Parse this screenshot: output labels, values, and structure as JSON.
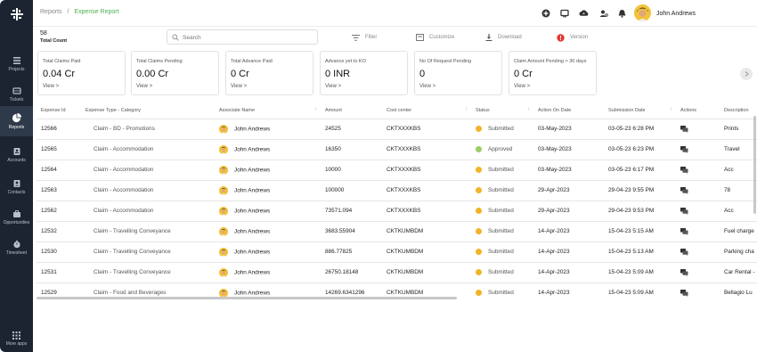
{
  "app": {
    "title": "Expense Report"
  },
  "sidebar": {
    "items": [
      {
        "label": "Projects",
        "icon": "list-icon"
      },
      {
        "label": "Tickets",
        "icon": "ticket-icon"
      },
      {
        "label": "Reports",
        "icon": "pie-chart-icon",
        "active": true
      },
      {
        "label": "Accounts",
        "icon": "id-card-icon"
      },
      {
        "label": "Contacts",
        "icon": "contacts-icon"
      },
      {
        "label": "Opportunities",
        "icon": "briefcase-icon"
      },
      {
        "label": "Timesheet",
        "icon": "stopwatch-icon"
      },
      {
        "label": "More apps",
        "icon": "grid-icon"
      }
    ]
  },
  "header": {
    "breadcrumb_root": "Reports",
    "breadcrumb_sep": "/",
    "breadcrumb_current": "Expense Report",
    "user_name": "John Andrews"
  },
  "toolbar": {
    "count": "58",
    "count_label": "Total Count",
    "search_placeholder": "Search",
    "filter_label": "Filter",
    "customize_label": "Customize",
    "download_label": "Download",
    "version_label": "Version"
  },
  "cards": [
    {
      "title": "Total Claims Paid",
      "value": "0.04 Cr",
      "link": "View >"
    },
    {
      "title": "Total Claims Pending",
      "value": "0.00 Cr",
      "link": "View >"
    },
    {
      "title": "Total Advance Paid",
      "value": "0 Cr",
      "link": "View >"
    },
    {
      "title": "Advance yet to KO",
      "value": "0 INR",
      "link": "View >"
    },
    {
      "title": "No Of Request Pending",
      "value": "0",
      "link": "View >"
    },
    {
      "title": "Claim Amount Pending > 30 days",
      "value": "0 Cr",
      "link": "View >"
    }
  ],
  "table": {
    "columns": [
      "Expense Id",
      "Expense Type - Category",
      "Associate Name",
      "Amount",
      "Cost center",
      "Status",
      "Action On Date",
      "Submission Date",
      "Actions",
      "Description"
    ],
    "rows": [
      {
        "id": "12566",
        "type": "Claim - BD - Promotions",
        "name": "John Andrews",
        "amount": "24525",
        "cost": "CKTXXXKBS",
        "status": "Submitted",
        "action_date": "03-May-2023",
        "sub_date": "03-05-23 6:28 PM",
        "desc": "Prints"
      },
      {
        "id": "12565",
        "type": "Claim - Accommodation",
        "name": "John Andrews",
        "amount": "16350",
        "cost": "CKTXXXKBS",
        "status": "Approved",
        "action_date": "03-May-2023",
        "sub_date": "03-05-23 6:23 PM",
        "desc": "Travel"
      },
      {
        "id": "12564",
        "type": "Claim - Accommodation",
        "name": "John Andrews",
        "amount": "10000",
        "cost": "CKTXXXKBS",
        "status": "Submitted",
        "action_date": "03-May-2023",
        "sub_date": "03-05-23 6:17 PM",
        "desc": "Acc"
      },
      {
        "id": "12563",
        "type": "Claim - Accommodation",
        "name": "John Andrews",
        "amount": "100000",
        "cost": "CKTXXXKBS",
        "status": "Submitted",
        "action_date": "29-Apr-2023",
        "sub_date": "29-04-23 9:55 PM",
        "desc": "78"
      },
      {
        "id": "12562",
        "type": "Claim - Accommodation",
        "name": "John Andrews",
        "amount": "73571.094",
        "cost": "CKTXXXKBS",
        "status": "Submitted",
        "action_date": "29-Apr-2023",
        "sub_date": "29-04-23 9:53 PM",
        "desc": "Acc"
      },
      {
        "id": "12532",
        "type": "Claim - Travelling Conveyance",
        "name": "John Andrews",
        "amount": "3683.55904",
        "cost": "CKTKUMBDM",
        "status": "Submitted",
        "action_date": "14-Apr-2023",
        "sub_date": "15-04-23 5:15 AM",
        "desc": "Fuel charge"
      },
      {
        "id": "12530",
        "type": "Claim - Travelling Conveyance",
        "name": "John Andrews",
        "amount": "886.77825",
        "cost": "CKTKUMBDM",
        "status": "Submitted",
        "action_date": "14-Apr-2023",
        "sub_date": "15-04-23 5:13 AM",
        "desc": "Parking cha"
      },
      {
        "id": "12531",
        "type": "Claim - Travelling Conveyance",
        "name": "John Andrews",
        "amount": "26750.18148",
        "cost": "CKTKUMBDM",
        "status": "Submitted",
        "action_date": "14-Apr-2023",
        "sub_date": "15-04-23 5:09 AM",
        "desc": "Car Rental -"
      },
      {
        "id": "12529",
        "type": "Claim - Food and Beverages",
        "name": "John Andrews",
        "amount": "14269.6341296",
        "cost": "CKTKUMBDM",
        "status": "Submitted",
        "action_date": "14-Apr-2023",
        "sub_date": "15-04-23 5:09 AM",
        "desc": "Bellagio Lu"
      }
    ]
  },
  "colors": {
    "sidebar_bg": "#1b2430",
    "accent_green": "#4caf50",
    "submitted_dot": "#f0b429",
    "approved_dot": "#9ccc65",
    "alert_red": "#e53935"
  }
}
